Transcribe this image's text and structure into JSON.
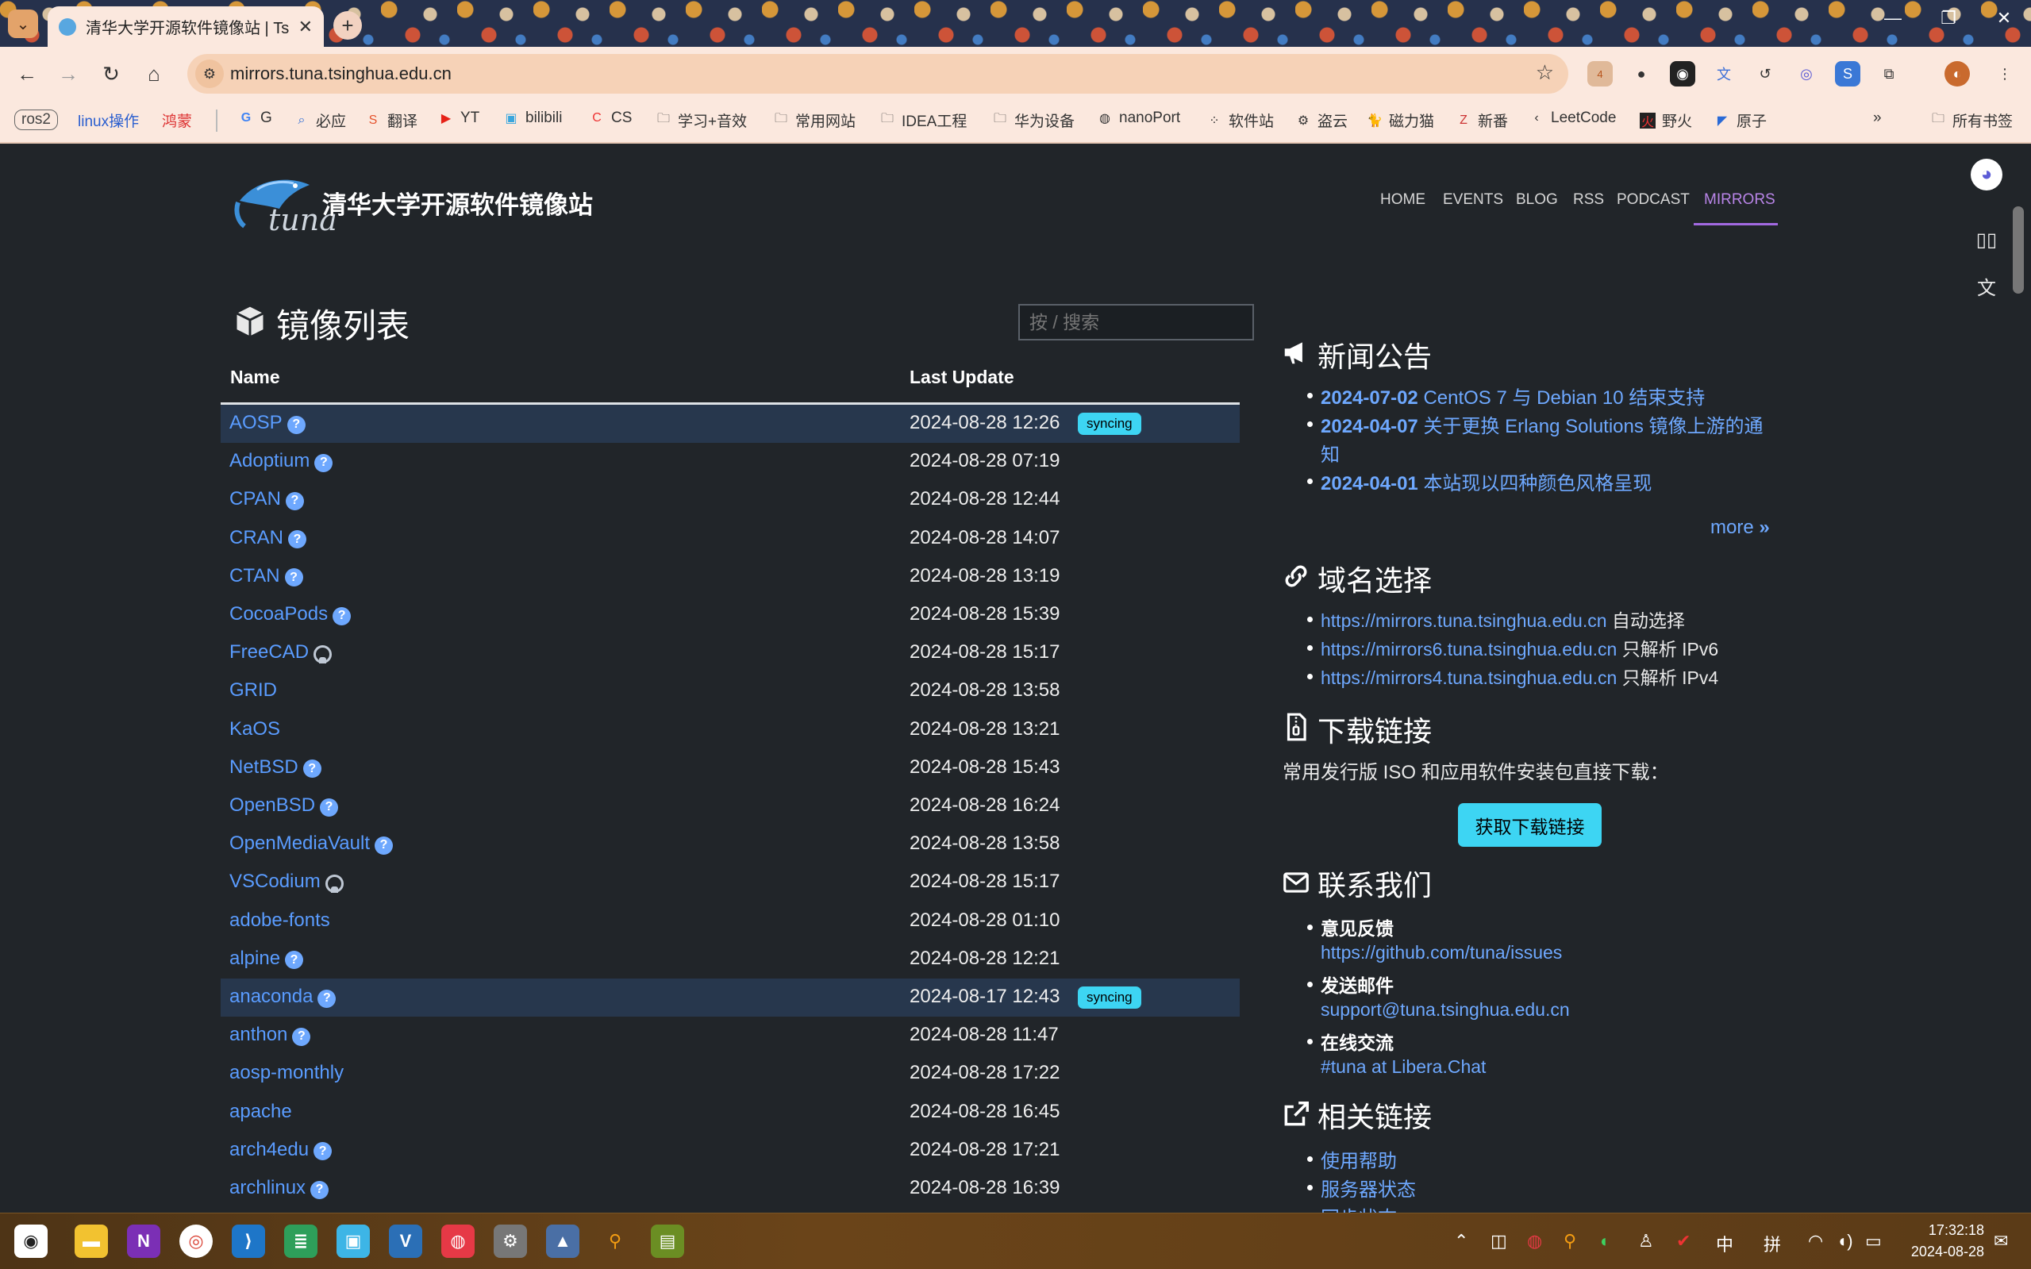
{
  "browser": {
    "tab_title": "清华大学开源软件镜像站 | Tsin",
    "url": "mirrors.tuna.tsinghua.edu.cn",
    "ext_badge": "4",
    "bookmarks": [
      {
        "label": "ros2"
      },
      {
        "label": "linux操作"
      },
      {
        "label": "鸿蒙"
      },
      {
        "label": "G"
      },
      {
        "label": "必应"
      },
      {
        "label": "翻译"
      },
      {
        "label": "YT"
      },
      {
        "label": "bilibili"
      },
      {
        "label": "CS"
      },
      {
        "label": "学习+音效"
      },
      {
        "label": "常用网站"
      },
      {
        "label": "IDEA工程"
      },
      {
        "label": "华为设备"
      },
      {
        "label": "nanoPort"
      },
      {
        "label": "软件站"
      },
      {
        "label": "盗云"
      },
      {
        "label": "磁力猫"
      },
      {
        "label": "新番"
      },
      {
        "label": "LeetCode"
      },
      {
        "label": "野火"
      },
      {
        "label": "原子"
      },
      {
        "label": "所有书签"
      }
    ]
  },
  "site": {
    "logo_text": "tuna",
    "title": "清华大学开源软件镜像站",
    "nav": [
      "HOME",
      "EVENTS",
      "BLOG",
      "RSS",
      "PODCAST",
      "MIRRORS"
    ]
  },
  "mirrors": {
    "heading": "镜像列表",
    "search_placeholder": "按 / 搜索",
    "col_name": "Name",
    "col_update": "Last Update",
    "rows": [
      {
        "name": "AOSP",
        "date": "2024-08-28 12:26",
        "badge": "syncing",
        "icon": "help"
      },
      {
        "name": "Adoptium",
        "date": "2024-08-28 07:19",
        "icon": "help"
      },
      {
        "name": "CPAN",
        "date": "2024-08-28 12:44",
        "icon": "help"
      },
      {
        "name": "CRAN",
        "date": "2024-08-28 14:07",
        "icon": "help"
      },
      {
        "name": "CTAN",
        "date": "2024-08-28 13:19",
        "icon": "help"
      },
      {
        "name": "CocoaPods",
        "date": "2024-08-28 15:39",
        "icon": "help"
      },
      {
        "name": "FreeCAD",
        "date": "2024-08-28 15:17",
        "icon": "github"
      },
      {
        "name": "GRID",
        "date": "2024-08-28 13:58"
      },
      {
        "name": "KaOS",
        "date": "2024-08-28 13:21"
      },
      {
        "name": "NetBSD",
        "date": "2024-08-28 15:43",
        "icon": "help"
      },
      {
        "name": "OpenBSD",
        "date": "2024-08-28 16:24",
        "icon": "help"
      },
      {
        "name": "OpenMediaVault",
        "date": "2024-08-28 13:58",
        "icon": "help"
      },
      {
        "name": "VSCodium",
        "date": "2024-08-28 15:17",
        "icon": "github"
      },
      {
        "name": "adobe-fonts",
        "date": "2024-08-28 01:10"
      },
      {
        "name": "alpine",
        "date": "2024-08-28 12:21",
        "icon": "help"
      },
      {
        "name": "anaconda",
        "date": "2024-08-17 12:43",
        "badge": "syncing",
        "icon": "help"
      },
      {
        "name": "anthon",
        "date": "2024-08-28 11:47",
        "icon": "help"
      },
      {
        "name": "aosp-monthly",
        "date": "2024-08-28 17:22"
      },
      {
        "name": "apache",
        "date": "2024-08-28 16:45"
      },
      {
        "name": "arch4edu",
        "date": "2024-08-28 17:21",
        "icon": "help"
      },
      {
        "name": "archlinux",
        "date": "2024-08-28 16:39",
        "icon": "help"
      }
    ]
  },
  "news": {
    "heading": "新闻公告",
    "items": [
      {
        "date": "2024-07-02",
        "text": "CentOS 7 与 Debian 10 结束支持"
      },
      {
        "date": "2024-04-07",
        "text": "关于更换 Erlang Solutions 镜像上游的通",
        "cont": "知"
      },
      {
        "date": "2024-04-01",
        "text": "本站现以四种颜色风格呈现"
      }
    ],
    "more": "more"
  },
  "domains": {
    "heading": "域名选择",
    "items": [
      {
        "url": "https://mirrors.tuna.tsinghua.edu.cn",
        "note": "自动选择"
      },
      {
        "url": "https://mirrors6.tuna.tsinghua.edu.cn",
        "note": "只解析 IPv6"
      },
      {
        "url": "https://mirrors4.tuna.tsinghua.edu.cn",
        "note": "只解析 IPv4"
      }
    ]
  },
  "downloads": {
    "heading": "下载链接",
    "text": "常用发行版 ISO 和应用软件安装包直接下载：",
    "button": "获取下载链接"
  },
  "contact": {
    "heading": "联系我们",
    "items": [
      {
        "label": "意见反馈",
        "value": "https://github.com/tuna/issues"
      },
      {
        "label": "发送邮件",
        "value": "support@tuna.tsinghua.edu.cn"
      },
      {
        "label": "在线交流",
        "value": "#tuna at Libera.Chat"
      }
    ]
  },
  "related": {
    "heading": "相关链接",
    "items": [
      "使用帮助",
      "服务器状态",
      "同步状态"
    ]
  },
  "taskbar": {
    "tray_ime": "中",
    "tray_pinyin": "拼",
    "time": "17:32:18",
    "date": "2024-08-28"
  },
  "colors": {
    "page_bg": "#212529",
    "link": "#6ea8fe",
    "badge": "#3dd5f3",
    "active_nav": "#b985e8"
  }
}
